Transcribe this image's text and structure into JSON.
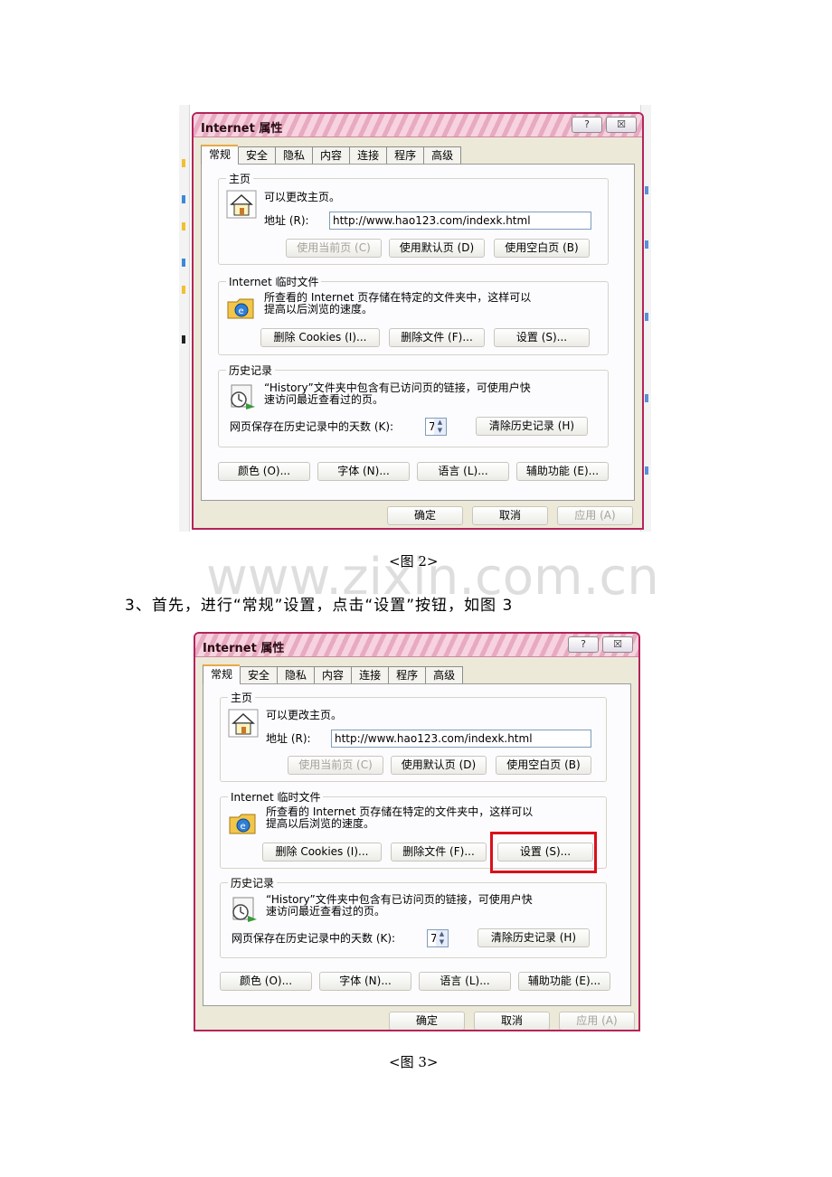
{
  "dialog": {
    "title": "Internet 属性",
    "help_btn": "?",
    "close_btn": "☒",
    "tabs": [
      "常规",
      "安全",
      "隐私",
      "内容",
      "连接",
      "程序",
      "高级"
    ],
    "homepage": {
      "label": "主页",
      "desc": "可以更改主页。",
      "address_label": "地址 (R):",
      "address_value": "http://www.hao123.com/indexk.html",
      "buttons": [
        "使用当前页 (C)",
        "使用默认页 (D)",
        "使用空白页 (B)"
      ]
    },
    "temp_files": {
      "label": "Internet 临时文件",
      "desc_line1": "所查看的 Internet 页存储在特定的文件夹中，这样可以",
      "desc_line2": "提高以后浏览的速度。",
      "buttons": [
        "删除 Cookies (I)...",
        "删除文件 (F)...",
        "设置 (S)..."
      ]
    },
    "history": {
      "label": "历史记录",
      "desc_line1": "“History”文件夹中包含有已访问页的链接，可使用户快",
      "desc_line2": "速访问最近查看过的页。",
      "days_label": "网页保存在历史记录中的天数 (K):",
      "days_value": "7",
      "clear_button": "清除历史记录 (H)"
    },
    "bottom_buttons": [
      "颜色 (O)...",
      "字体 (N)...",
      "语言 (L)...",
      "辅助功能 (E)..."
    ],
    "ok": "确定",
    "cancel": "取消",
    "apply": "应用 (A)"
  },
  "caption_fig2": "<图 2>",
  "step_text": "3、首先，进行“常规”设置，点击“设置”按钮，如图 3",
  "caption_fig3": "<图 3>",
  "watermark": "www.zixin.com.cn",
  "colors": {
    "dialog_border": "#b4245b",
    "highlight_box": "#d8101b"
  }
}
